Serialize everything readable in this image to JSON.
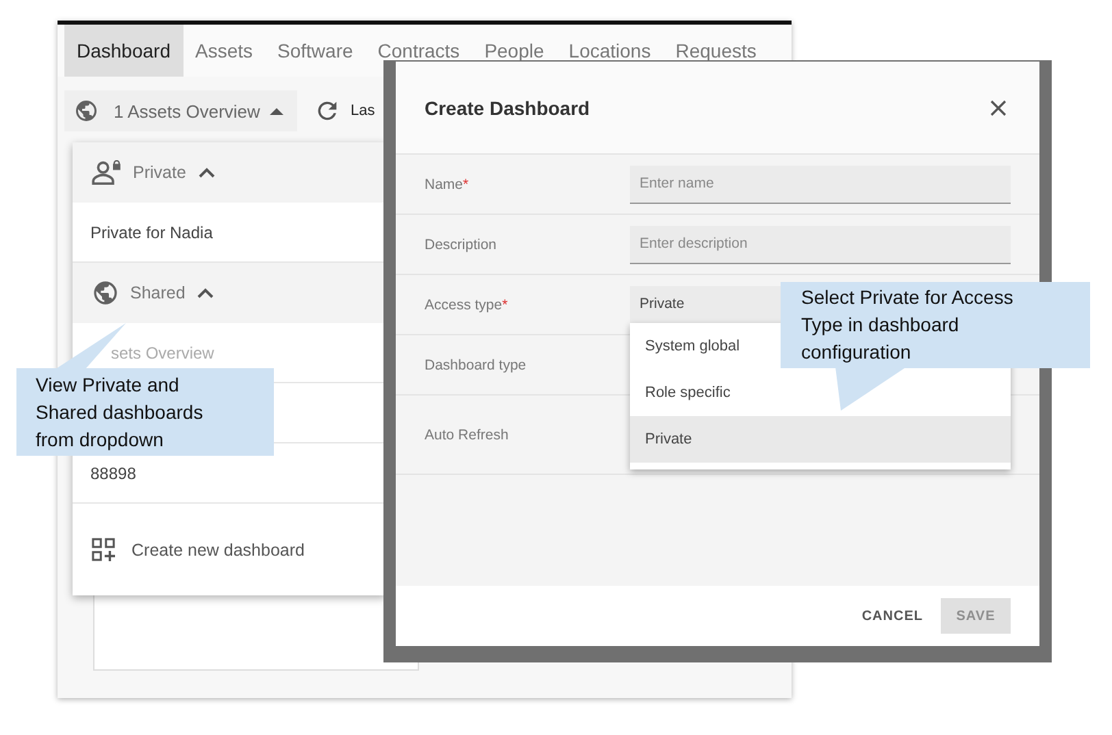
{
  "app": {
    "tabs": [
      {
        "label": "Dashboard",
        "selected": true
      },
      {
        "label": "Assets",
        "selected": false
      },
      {
        "label": "Software",
        "selected": false
      },
      {
        "label": "Contracts",
        "selected": false
      },
      {
        "label": "People",
        "selected": false
      },
      {
        "label": "Locations",
        "selected": false
      },
      {
        "label": "Requests",
        "selected": false
      }
    ],
    "dashboard_selector": {
      "label": "1 Assets Overview",
      "expanded": true
    },
    "toolbar_text": "Las"
  },
  "dashboard_menu": {
    "groups": [
      {
        "kind": "private",
        "label": "Private",
        "expanded": true,
        "items": [
          {
            "label": "Private for Nadia",
            "selected": false
          }
        ]
      },
      {
        "kind": "shared",
        "label": "Shared",
        "expanded": true,
        "items": [
          {
            "label": "sets Overview",
            "selected": true
          },
          {
            "label": "88898",
            "selected": false
          }
        ]
      }
    ],
    "create_label": "Create new dashboard"
  },
  "dialog": {
    "title": "Create Dashboard",
    "fields": [
      {
        "kind": "text",
        "label": "Name",
        "required_mark": "*",
        "placeholder": "Enter name"
      },
      {
        "kind": "text",
        "label": "Description",
        "placeholder": "Enter description"
      },
      {
        "kind": "select",
        "label": "Access type",
        "required_mark": "*",
        "value": "Private"
      },
      {
        "kind": "none",
        "label": "Dashboard type"
      },
      {
        "kind": "none",
        "label": "Auto Refresh"
      }
    ],
    "access_options": [
      {
        "label": "System global",
        "selected": false
      },
      {
        "label": "Role specific",
        "selected": false
      },
      {
        "label": "Private",
        "selected": true
      }
    ],
    "buttons": [
      {
        "label": "CANCEL",
        "disabled": false
      },
      {
        "label": "SAVE",
        "disabled": true
      }
    ]
  },
  "callouts": [
    {
      "text": "View Private and Shared dashboards from dropdown"
    },
    {
      "text": "Select Private for Access Type in dashboard configuration"
    }
  ]
}
